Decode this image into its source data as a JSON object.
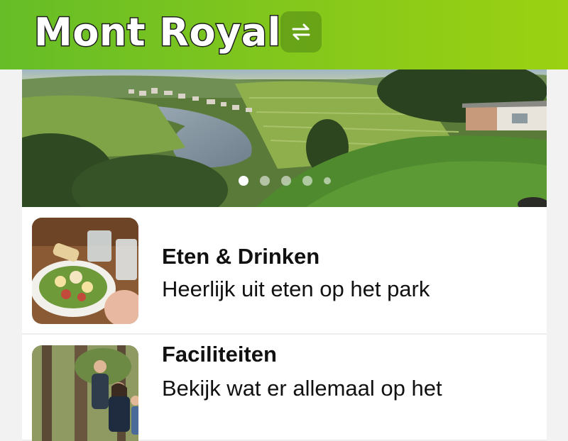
{
  "header": {
    "park_name": "Mont Royal",
    "switch_icon": "switch-park-icon",
    "background_from": "#66bd27",
    "background_to": "#9bd111"
  },
  "carousel": {
    "slide_count": 5,
    "active_index": 0
  },
  "items": [
    {
      "title": "Eten & Drinken",
      "subtitle": "Heerlijk uit eten op het park",
      "image": "food-photo"
    },
    {
      "title": "Faciliteiten",
      "subtitle": "Bekijk wat er allemaal op het",
      "image": "family-forest-photo"
    }
  ]
}
